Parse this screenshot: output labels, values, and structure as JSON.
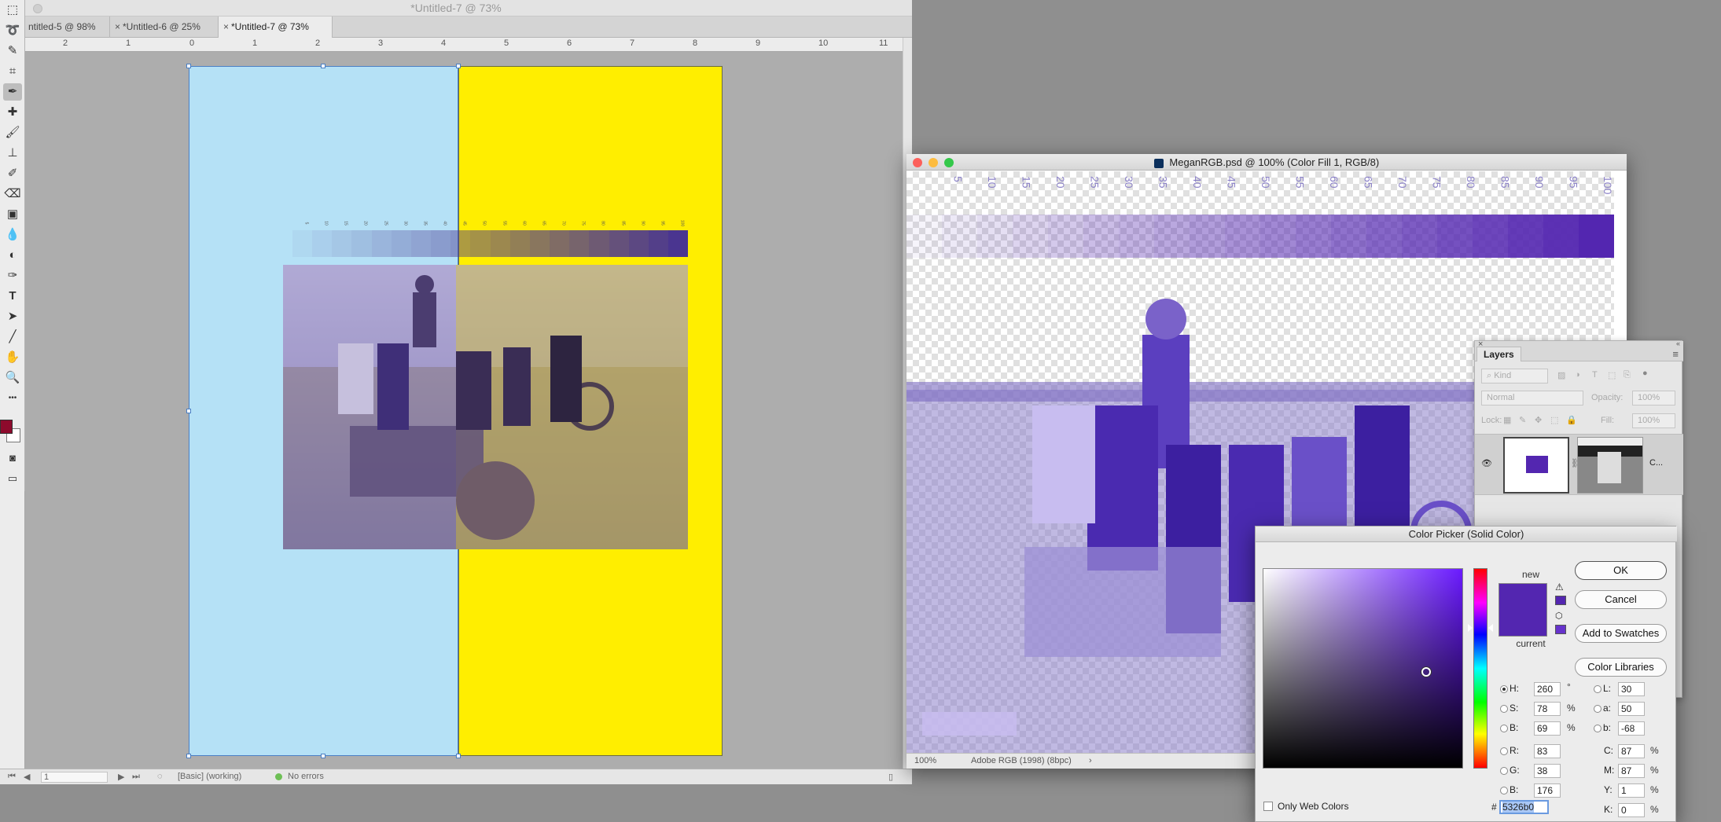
{
  "window1": {
    "title": "*Untitled-7 @ 73%",
    "tabs": [
      {
        "label": "ntitled-5 @ 98%"
      },
      {
        "label": "*Untitled-6 @ 25%",
        "close": "×"
      },
      {
        "label": "*Untitled-7 @ 73%",
        "close": "×"
      }
    ],
    "ruler_numbers": [
      "2",
      "1",
      "0",
      "1",
      "2",
      "3",
      "4",
      "5",
      "6",
      "7",
      "8",
      "9",
      "10",
      "11"
    ],
    "status": {
      "page": "1",
      "profile": "[Basic] (working)",
      "errors": "No errors"
    }
  },
  "toolbar": {
    "tools": [
      "marquee-icon",
      "lasso-icon",
      "quick-select-icon",
      "crop-icon",
      "eyedropper-icon",
      "healing-icon",
      "brush-icon",
      "stamp-icon",
      "history-brush-icon",
      "eraser-icon",
      "gradient-icon",
      "blur-icon",
      "dodge-icon",
      "pen-icon",
      "type-icon",
      "path-select-icon",
      "line-icon",
      "hand-icon",
      "zoom-icon",
      "more-icon"
    ],
    "glyphs": [
      "⬚",
      "➰",
      "✎",
      "⌗",
      "✒",
      "✚",
      "🖌",
      "⊥",
      "✐",
      "⌫",
      "▣",
      "💧",
      "◐",
      "✑",
      "T",
      "➤",
      "╱",
      "✋",
      "🔍",
      "•••"
    ],
    "foreground": "#8d0a2c",
    "background": "#ffffff"
  },
  "strip_ticks_small": [
    "5",
    "10",
    "15",
    "20",
    "25",
    "30",
    "35",
    "40",
    "45",
    "50",
    "55",
    "60",
    "65",
    "70",
    "75",
    "80",
    "85",
    "90",
    "95",
    "100"
  ],
  "window2": {
    "title": "MeganRGB.psd @ 100% (Color Fill 1, RGB/8)",
    "ticks": [
      "5",
      "10",
      "15",
      "20",
      "25",
      "30",
      "35",
      "40",
      "45",
      "50",
      "55",
      "60",
      "65",
      "70",
      "75",
      "80",
      "85",
      "90",
      "95",
      "100"
    ],
    "status": {
      "zoom": "100%",
      "profile": "Adobe RGB (1998) (8bpc)",
      "arrow": "›"
    }
  },
  "layers": {
    "tab": "Layers",
    "close": "×",
    "menu": "≡",
    "kind_placeholder": "Kind",
    "blend_mode": "Normal",
    "opacity_label": "Opacity:",
    "opacity": "100%",
    "lock_label": "Lock:",
    "fill_label": "Fill:",
    "fill": "100%",
    "layer_name": "C...",
    "eye": "👁"
  },
  "picker": {
    "title": "Color Picker (Solid Color)",
    "new_label": "new",
    "current_label": "current",
    "buttons": {
      "ok": "OK",
      "cancel": "Cancel",
      "swatches": "Add to Swatches",
      "libraries": "Color Libraries"
    },
    "fields": {
      "H": {
        "label": "H:",
        "value": "260",
        "unit": "°"
      },
      "S": {
        "label": "S:",
        "value": "78",
        "unit": "%"
      },
      "B": {
        "label": "B:",
        "value": "69",
        "unit": "%"
      },
      "R": {
        "label": "R:",
        "value": "83"
      },
      "G": {
        "label": "G:",
        "value": "38"
      },
      "Bl": {
        "label": "B:",
        "value": "176"
      },
      "L": {
        "label": "L:",
        "value": "30"
      },
      "a": {
        "label": "a:",
        "value": "50"
      },
      "b": {
        "label": "b:",
        "value": "-68"
      },
      "C": {
        "label": "C:",
        "value": "87",
        "unit": "%"
      },
      "M": {
        "label": "M:",
        "value": "87",
        "unit": "%"
      },
      "Y": {
        "label": "Y:",
        "value": "1",
        "unit": "%"
      },
      "K": {
        "label": "K:",
        "value": "0",
        "unit": "%"
      }
    },
    "hex_label": "#",
    "hex": "5326b0",
    "only_web": "Only Web Colors",
    "color": "#5326b0"
  }
}
